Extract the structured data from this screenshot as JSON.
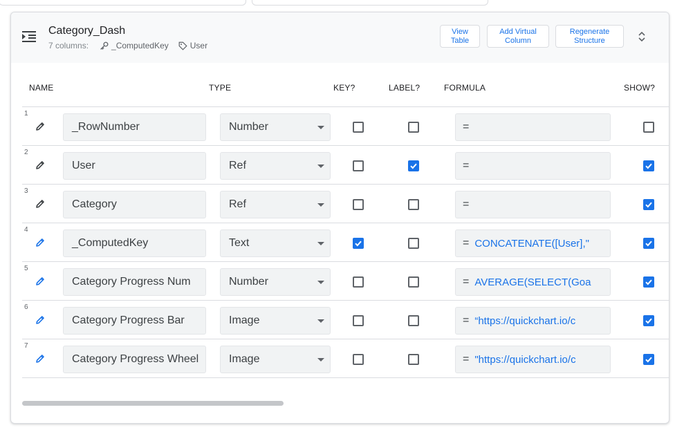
{
  "table": {
    "title": "Category_Dash",
    "columns_count": "7 columns:",
    "key_chip": "_ComputedKey",
    "label_chip": "User",
    "buttons": {
      "view_table": "View Table",
      "add_virtual_column": "Add Virtual Column",
      "regenerate_structure": "Regenerate Structure"
    }
  },
  "headers": {
    "name": "NAME",
    "type": "TYPE",
    "key": "KEY?",
    "label": "LABEL?",
    "formula": "FORMULA",
    "show": "SHOW?"
  },
  "rows": [
    {
      "num": "1",
      "name": "_RowNumber",
      "type": "Number",
      "key": false,
      "label": false,
      "formula_eq": "=",
      "formula": "",
      "show": false,
      "virtual": false
    },
    {
      "num": "2",
      "name": "User",
      "type": "Ref",
      "key": false,
      "label": true,
      "formula_eq": "=",
      "formula": "",
      "show": true,
      "virtual": false
    },
    {
      "num": "3",
      "name": "Category",
      "type": "Ref",
      "key": false,
      "label": false,
      "formula_eq": "=",
      "formula": "",
      "show": true,
      "virtual": false
    },
    {
      "num": "4",
      "name": "_ComputedKey",
      "type": "Text",
      "key": true,
      "label": false,
      "formula_eq": "=",
      "formula": "CONCATENATE([User],\"",
      "show": true,
      "virtual": true
    },
    {
      "num": "5",
      "name": "Category Progress Num",
      "type": "Number",
      "key": false,
      "label": false,
      "formula_eq": "=",
      "formula": "AVERAGE(SELECT(Goa",
      "show": true,
      "virtual": true
    },
    {
      "num": "6",
      "name": "Category Progress Bar",
      "type": "Image",
      "key": false,
      "label": false,
      "formula_eq": "=",
      "formula": "“https://quickchart.io/c",
      "show": true,
      "virtual": true
    },
    {
      "num": "7",
      "name": "Category Progress Wheel",
      "type": "Image",
      "key": false,
      "label": false,
      "formula_eq": "=",
      "formula": "\"https://quickchart.io/c",
      "show": true,
      "virtual": true
    }
  ],
  "colors": {
    "accent": "#1a73e8",
    "icon_dark": "#3c4043"
  }
}
